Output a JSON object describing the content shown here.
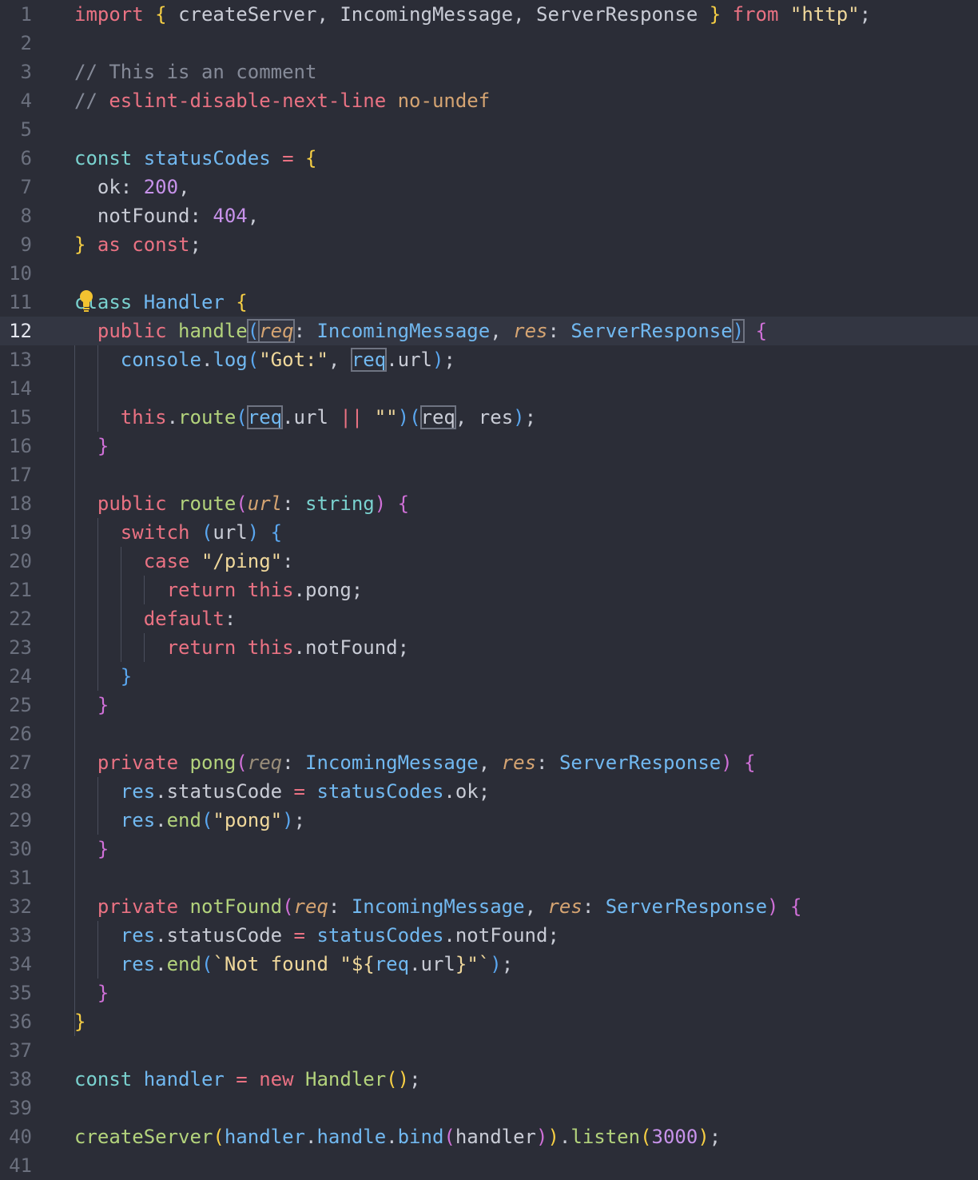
{
  "editor": {
    "active_line": 12,
    "colors": {
      "background": "#2b2d37",
      "active_line": "#333642",
      "keyword": "#ea7283",
      "declaration": "#7ad2cf",
      "type": "#71b8f0",
      "function": "#b3d37c",
      "string": "#f0d89b",
      "number": "#c792ea",
      "comment": "#858a98",
      "brace_yellow": "#f7cf44",
      "brace_magenta": "#d070d8",
      "brace_blue": "#5aa7f0",
      "parameter": "#d5a472",
      "plain": "#c9ccd6"
    },
    "lightbulb_icon": "lightbulb-icon",
    "lines": [
      [
        [
          "import ",
          "kw"
        ],
        [
          "{ ",
          "by"
        ],
        [
          "createServer, IncomingMessage, ServerResponse ",
          ""
        ],
        [
          "} ",
          "by"
        ],
        [
          "from ",
          "kw"
        ],
        [
          "\"http\"",
          "str"
        ],
        [
          ";",
          ""
        ]
      ],
      [],
      [
        [
          "// This is an comment",
          "cm"
        ]
      ],
      [
        [
          "// ",
          "cm"
        ],
        [
          "eslint-disable-next-line ",
          "kw"
        ],
        [
          "no-undef",
          "prm"
        ]
      ],
      [],
      [
        [
          "const ",
          "decl"
        ],
        [
          "statusCodes ",
          "ty"
        ],
        [
          "= ",
          "kw"
        ],
        [
          "{",
          "by"
        ]
      ],
      [
        [
          "  ok: ",
          ""
        ],
        [
          "200",
          "num"
        ],
        [
          ",",
          ""
        ]
      ],
      [
        [
          "  notFound: ",
          ""
        ],
        [
          "404",
          "num"
        ],
        [
          ",",
          ""
        ]
      ],
      [
        [
          "} ",
          "by"
        ],
        [
          "as const",
          "kw"
        ],
        [
          ";",
          ""
        ]
      ],
      [],
      [
        [
          "class ",
          "decl"
        ],
        [
          "Handler ",
          "ty"
        ],
        [
          "{",
          "by"
        ]
      ],
      [
        [
          "  public ",
          "kw"
        ],
        [
          "handle",
          "fn"
        ],
        [
          "(",
          "bb"
        ],
        [
          "req",
          "prmi"
        ],
        [
          ": ",
          ""
        ],
        [
          "IncomingMessage",
          "ty"
        ],
        [
          ", ",
          ""
        ],
        [
          "res",
          "prmi"
        ],
        [
          ": ",
          ""
        ],
        [
          "ServerResponse",
          "ty"
        ],
        [
          ")",
          "bb"
        ],
        [
          " ",
          ""
        ],
        [
          "{",
          "bm"
        ]
      ],
      [
        [
          "    console",
          "ty"
        ],
        [
          ".",
          ""
        ],
        [
          "log",
          "ty"
        ],
        [
          "(",
          "bb"
        ],
        [
          "\"Got:\"",
          "str"
        ],
        [
          ", ",
          ""
        ],
        [
          "req",
          "ty"
        ],
        [
          ".url",
          ""
        ],
        [
          ")",
          "bb"
        ],
        [
          ";",
          ""
        ]
      ],
      [],
      [
        [
          "    this",
          "kw"
        ],
        [
          ".",
          ""
        ],
        [
          "route",
          "fn"
        ],
        [
          "(",
          "bb"
        ],
        [
          "req",
          "ty"
        ],
        [
          ".url ",
          ""
        ],
        [
          "|| ",
          "kw"
        ],
        [
          "\"\"",
          "str"
        ],
        [
          ")",
          "bb"
        ],
        [
          "(",
          "bb"
        ],
        [
          "req",
          ""
        ],
        [
          ", res",
          ""
        ],
        [
          ")",
          "bb"
        ],
        [
          ";",
          ""
        ]
      ],
      [
        [
          "  }",
          "bm"
        ]
      ],
      [],
      [
        [
          "  public ",
          "kw"
        ],
        [
          "route",
          "fn"
        ],
        [
          "(",
          "bm"
        ],
        [
          "url",
          "prmi"
        ],
        [
          ": ",
          ""
        ],
        [
          "string",
          "decl"
        ],
        [
          ") ",
          "bm"
        ],
        [
          "{",
          "bm"
        ]
      ],
      [
        [
          "    switch ",
          "kw"
        ],
        [
          "(",
          "bb"
        ],
        [
          "url",
          ""
        ],
        [
          ") ",
          "bb"
        ],
        [
          "{",
          "bb"
        ]
      ],
      [
        [
          "      case ",
          "kw"
        ],
        [
          "\"/ping\"",
          "str"
        ],
        [
          ":",
          ""
        ]
      ],
      [
        [
          "        return ",
          "kw"
        ],
        [
          "this",
          "kw"
        ],
        [
          ".pong;",
          ""
        ]
      ],
      [
        [
          "      default",
          "kw"
        ],
        [
          ":",
          ""
        ]
      ],
      [
        [
          "        return ",
          "kw"
        ],
        [
          "this",
          "kw"
        ],
        [
          ".notFound;",
          ""
        ]
      ],
      [
        [
          "    }",
          "bb"
        ]
      ],
      [
        [
          "  }",
          "bm"
        ]
      ],
      [],
      [
        [
          "  private ",
          "kw"
        ],
        [
          "pong",
          "fn"
        ],
        [
          "(",
          "bm"
        ],
        [
          "req",
          "prmd"
        ],
        [
          ": ",
          ""
        ],
        [
          "IncomingMessage",
          "ty"
        ],
        [
          ", ",
          ""
        ],
        [
          "res",
          "prmi"
        ],
        [
          ": ",
          ""
        ],
        [
          "ServerResponse",
          "ty"
        ],
        [
          ") ",
          "bm"
        ],
        [
          "{",
          "bm"
        ]
      ],
      [
        [
          "    res",
          "ty"
        ],
        [
          ".statusCode ",
          ""
        ],
        [
          "= ",
          "kw"
        ],
        [
          "statusCodes",
          "ty"
        ],
        [
          ".ok;",
          ""
        ]
      ],
      [
        [
          "    res",
          "ty"
        ],
        [
          ".",
          ""
        ],
        [
          "end",
          "fn"
        ],
        [
          "(",
          "bb"
        ],
        [
          "\"pong\"",
          "str"
        ],
        [
          ")",
          "bb"
        ],
        [
          ";",
          ""
        ]
      ],
      [
        [
          "  }",
          "bm"
        ]
      ],
      [],
      [
        [
          "  private ",
          "kw"
        ],
        [
          "notFound",
          "fn"
        ],
        [
          "(",
          "bm"
        ],
        [
          "req",
          "prmi"
        ],
        [
          ": ",
          ""
        ],
        [
          "IncomingMessage",
          "ty"
        ],
        [
          ", ",
          ""
        ],
        [
          "res",
          "prmi"
        ],
        [
          ": ",
          ""
        ],
        [
          "ServerResponse",
          "ty"
        ],
        [
          ") ",
          "bm"
        ],
        [
          "{",
          "bm"
        ]
      ],
      [
        [
          "    res",
          "ty"
        ],
        [
          ".statusCode ",
          ""
        ],
        [
          "= ",
          "kw"
        ],
        [
          "statusCodes",
          "ty"
        ],
        [
          ".notFound;",
          ""
        ]
      ],
      [
        [
          "    res",
          "ty"
        ],
        [
          ".",
          ""
        ],
        [
          "end",
          "fn"
        ],
        [
          "(",
          "bb"
        ],
        [
          "`Not found \"",
          "str"
        ],
        [
          "${",
          "str"
        ],
        [
          "req",
          "ty"
        ],
        [
          ".url",
          ""
        ],
        [
          "}",
          "str"
        ],
        [
          "\"`",
          "str"
        ],
        [
          ")",
          "bb"
        ],
        [
          ";",
          ""
        ]
      ],
      [
        [
          "  }",
          "bm"
        ]
      ],
      [
        [
          "}",
          "by"
        ]
      ],
      [],
      [
        [
          "const ",
          "decl"
        ],
        [
          "handler ",
          "ty"
        ],
        [
          "= ",
          "kw"
        ],
        [
          "new ",
          "kw"
        ],
        [
          "Handler",
          "fn"
        ],
        [
          "()",
          "by"
        ],
        [
          ";",
          ""
        ]
      ],
      [],
      [
        [
          "createServer",
          "fn"
        ],
        [
          "(",
          "by"
        ],
        [
          "handler",
          "ty"
        ],
        [
          ".",
          ""
        ],
        [
          "handle",
          "ty"
        ],
        [
          ".",
          ""
        ],
        [
          "bind",
          "ty"
        ],
        [
          "(",
          "bm"
        ],
        [
          "handler",
          ""
        ],
        [
          ")",
          "bm"
        ],
        [
          ")",
          "by"
        ],
        [
          ".",
          ""
        ],
        [
          "listen",
          "fn"
        ],
        [
          "(",
          "by"
        ],
        [
          "3000",
          "num"
        ],
        [
          ")",
          "by"
        ],
        [
          ";",
          ""
        ]
      ],
      []
    ]
  }
}
